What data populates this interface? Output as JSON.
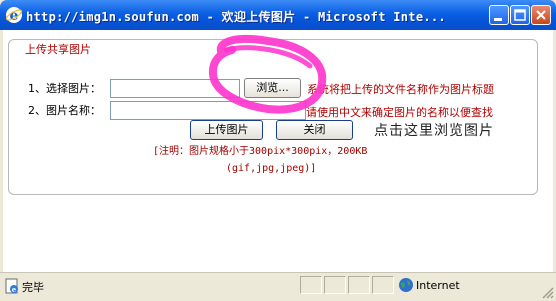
{
  "window": {
    "title": "http://img1n.soufun.com - 欢迎上传图片 - Microsoft Inte...",
    "icon": "ie-icon",
    "buttons": [
      "minimize",
      "maximize",
      "close"
    ]
  },
  "form": {
    "legend": "上传共享图片",
    "choose_label": "1、选择图片：",
    "browse_button": "浏览...",
    "choose_hint": "系统将把上传的文件名称作为图片标题",
    "name_label": "2、图片名称：",
    "name_hint": "请使用中文来确定图片的名称以便查找",
    "upload_button": "上传图片",
    "close_button": "关闭",
    "annotation": "点击这里浏览图片",
    "note_line1": "[注明：图片规格小于300pix*300pix，200KB",
    "note_line2": "(gif,jpg,jpeg)]"
  },
  "statusbar": {
    "status": "完毕",
    "zone": "Internet"
  },
  "colors": {
    "accent_red": "#b00000",
    "highlight_magenta": "#ff33cc",
    "titlebar_blue": "#0a5fe3"
  }
}
